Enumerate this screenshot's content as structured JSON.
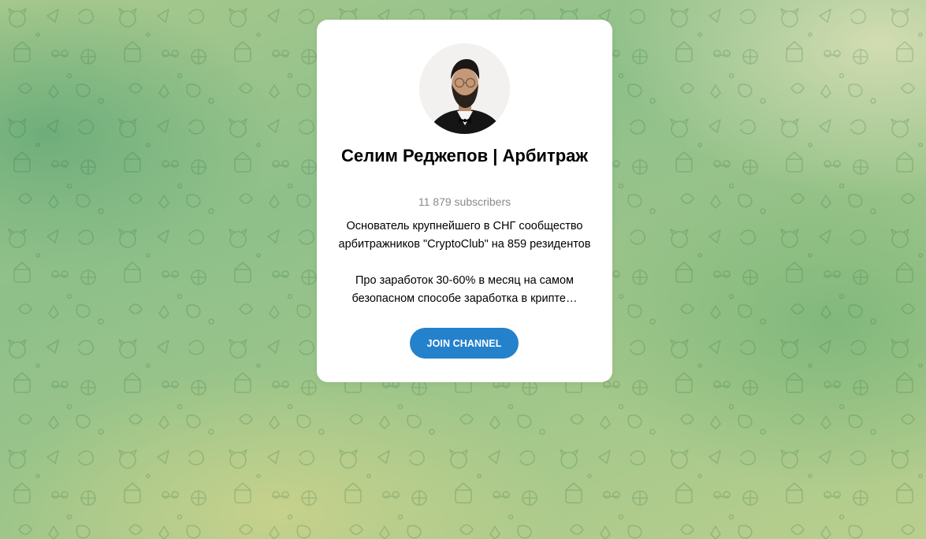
{
  "channel": {
    "title": "Селим Реджепов | Арбитраж",
    "subscribers": "11 879 subscribers",
    "description_line1": "Основатель крупнейшего в СНГ сообщество арбитражников \"CryptoClub\" на 859 резидентов",
    "description_line2": "Про заработок 30-60% в месяц на самом безопасном способе заработка в крипте…",
    "join_label": "JOIN CHANNEL"
  },
  "colors": {
    "accent": "#2481cc",
    "card": "#ffffff",
    "subtitle": "#8a8a8a"
  },
  "icons": {
    "background": "doodle-pattern",
    "avatar": "channel-avatar-photo"
  }
}
